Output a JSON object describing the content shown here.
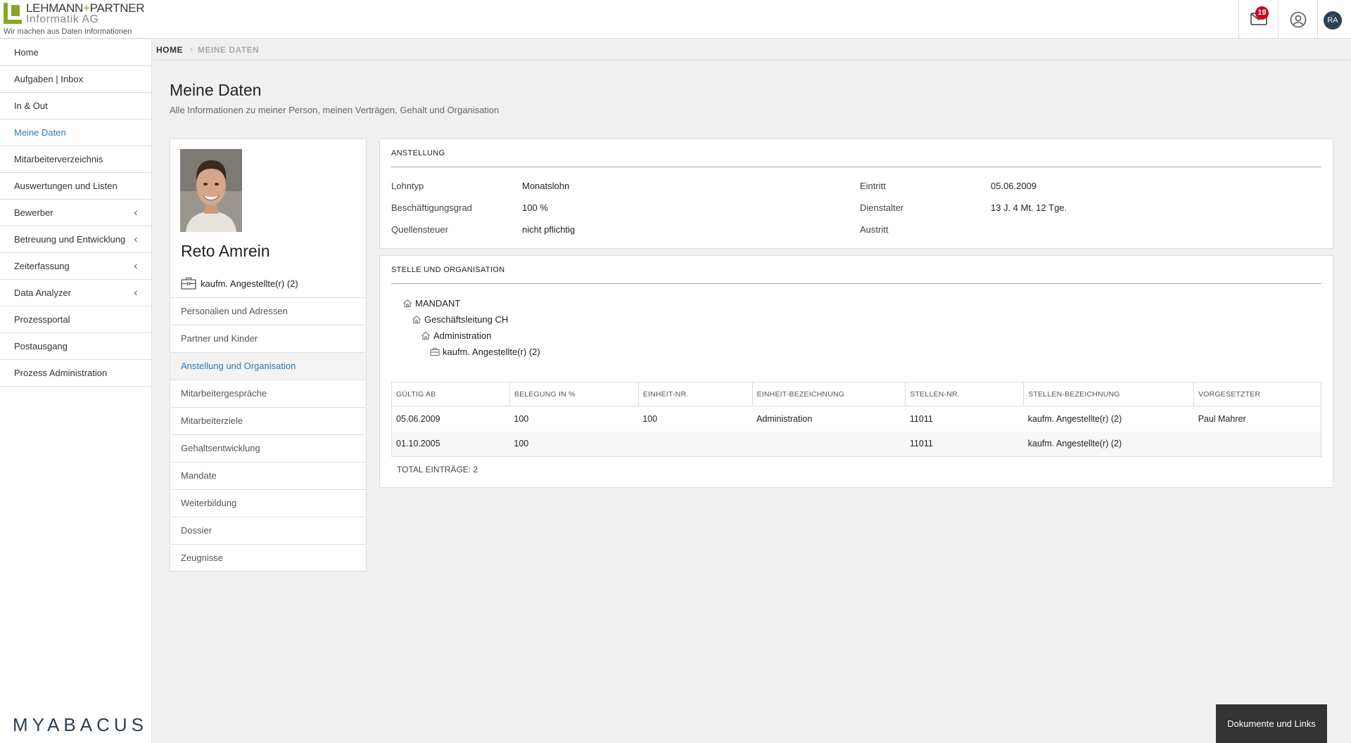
{
  "header": {
    "logo_line1_a": "LEHMANN",
    "logo_line1_plus": "+",
    "logo_line1_b": "PARTNER",
    "logo_line2": "Informatik AG",
    "logo_tagline": "Wir machen aus Daten Informationen",
    "notification_count": "19",
    "avatar_initials": "RA"
  },
  "sidebar": {
    "items": [
      {
        "label": "Home",
        "has_caret": false
      },
      {
        "label": "Aufgaben | Inbox",
        "has_caret": false
      },
      {
        "label": "In & Out",
        "has_caret": false
      },
      {
        "label": "Meine Daten",
        "has_caret": false,
        "active": true
      },
      {
        "label": "Mitarbeiterverzeichnis",
        "has_caret": false
      },
      {
        "label": "Auswertungen und Listen",
        "has_caret": false
      },
      {
        "label": "Bewerber",
        "has_caret": true
      },
      {
        "label": "Betreuung und Entwicklung",
        "has_caret": true
      },
      {
        "label": "Zeiterfassung",
        "has_caret": true
      },
      {
        "label": "Data Analyzer",
        "has_caret": true
      },
      {
        "label": "Prozessportal",
        "has_caret": false
      },
      {
        "label": "Postausgang",
        "has_caret": false
      },
      {
        "label": "Prozess Administration",
        "has_caret": false
      }
    ],
    "brand": "MYABACUS"
  },
  "breadcrumb": {
    "home": "HOME",
    "separator": "›",
    "current": "MEINE DATEN"
  },
  "page": {
    "title": "Meine Daten",
    "subtitle": "Alle Informationen zu meiner Person, meinen Verträgen, Gehalt und Organisation"
  },
  "profile": {
    "name": "Reto Amrein",
    "role": "kaufm. Angestellte(r) (2)",
    "menu": [
      {
        "label": "Personalien und Adressen"
      },
      {
        "label": "Partner und Kinder"
      },
      {
        "label": "Anstellung und Organisation",
        "active": true
      },
      {
        "label": "Mitarbeitergespräche"
      },
      {
        "label": "Mitarbeiterziele"
      },
      {
        "label": "Gehaltsentwicklung"
      },
      {
        "label": "Mandate"
      },
      {
        "label": "Weiterbildung"
      },
      {
        "label": "Dossier"
      },
      {
        "label": "Zeugnisse"
      }
    ]
  },
  "anstellung": {
    "title": "ANSTELLUNG",
    "lohntyp_label": "Lohntyp",
    "lohntyp_value": "Monatslohn",
    "grad_label": "Beschäftigungsgrad",
    "grad_value": "100 %",
    "quellensteuer_label": "Quellensteuer",
    "quellensteuer_value": "nicht pflichtig",
    "eintritt_label": "Eintritt",
    "eintritt_value": "05.06.2009",
    "dienstalter_label": "Dienstalter",
    "dienstalter_value": "13 J. 4 Mt. 12 Tge.",
    "austritt_label": "Austritt",
    "austritt_value": ""
  },
  "stelle": {
    "title": "STELLE UND ORGANISATION",
    "tree": [
      {
        "label": "MANDANT",
        "icon": "home-icon"
      },
      {
        "label": "Geschäftsleitung CH",
        "icon": "home-icon"
      },
      {
        "label": "Administration",
        "icon": "home-icon"
      },
      {
        "label": "kaufm. Angestellte(r) (2)",
        "icon": "briefcase-icon"
      }
    ],
    "columns": [
      "GÜLTIG AB",
      "BELEGUNG IN %",
      "EINHEIT-NR.",
      "EINHEIT-BEZEICHNUNG",
      "STELLEN-NR.",
      "STELLEN-BEZEICHNUNG",
      "VORGESETZTER"
    ],
    "rows": [
      [
        "05.06.2009",
        "100",
        "100",
        "Administration",
        "11011",
        "kaufm. Angestellte(r) (2)",
        "Paul Mahrer"
      ],
      [
        "01.10.2005",
        "100",
        "",
        "",
        "11011",
        "kaufm. Angestellte(r) (2)",
        ""
      ]
    ],
    "total": "TOTAL EINTRÄGE: 2"
  },
  "footer": {
    "documents_button": "Dokumente und Links"
  }
}
